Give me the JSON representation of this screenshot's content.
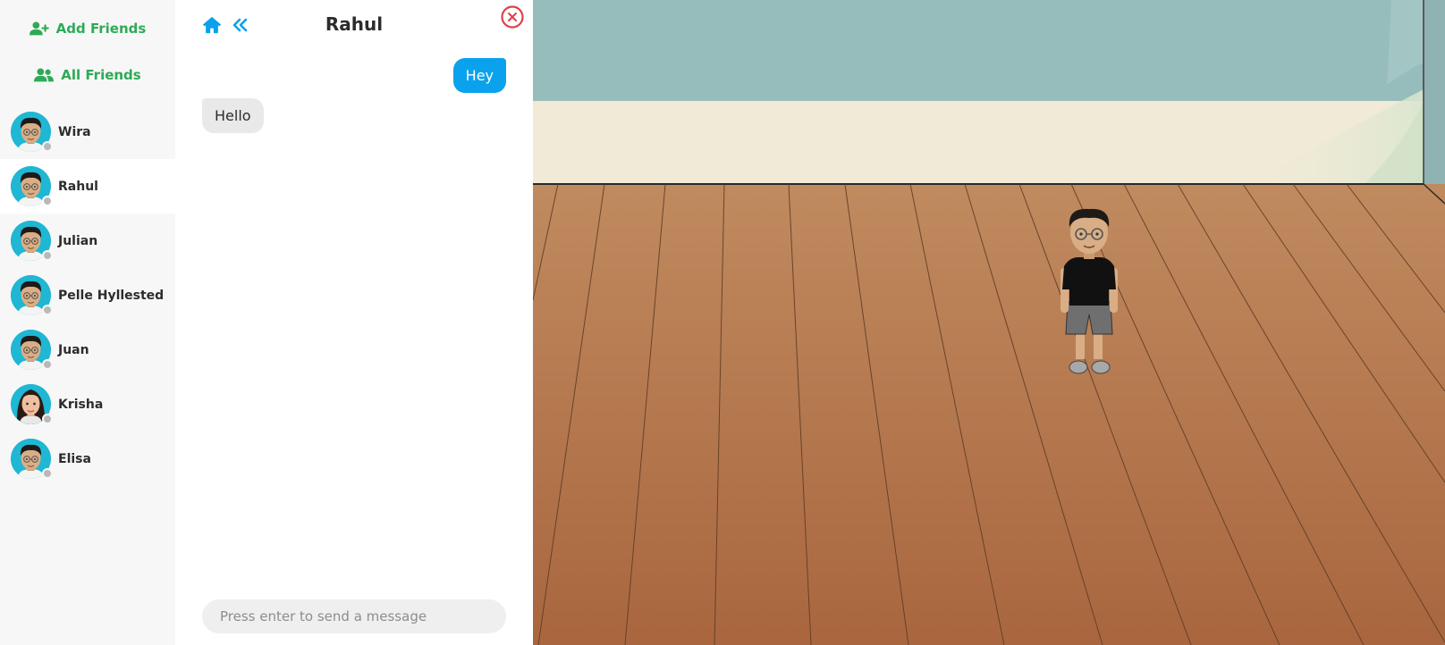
{
  "sidebar": {
    "add_friends_label": "Add Friends",
    "all_friends_label": "All Friends",
    "friends": [
      {
        "name": "Wira",
        "avatar": "male",
        "status": "offline",
        "active": false
      },
      {
        "name": "Rahul",
        "avatar": "male",
        "status": "offline",
        "active": true
      },
      {
        "name": "Julian",
        "avatar": "male",
        "status": "offline",
        "active": false
      },
      {
        "name": "Pelle Hyllested",
        "avatar": "male",
        "status": "offline",
        "active": false
      },
      {
        "name": "Juan",
        "avatar": "male",
        "status": "offline",
        "active": false
      },
      {
        "name": "Krisha",
        "avatar": "female",
        "status": "offline",
        "active": false
      },
      {
        "name": "Elisa",
        "avatar": "male",
        "status": "offline",
        "active": false
      }
    ]
  },
  "chat": {
    "title": "Rahul",
    "messages": [
      {
        "direction": "outgoing",
        "text": "Hey"
      },
      {
        "direction": "incoming",
        "text": "Hello"
      }
    ],
    "composer_placeholder": "Press enter to send a message"
  },
  "icons": {
    "home": "home-icon",
    "back": "double-chevron-left-icon",
    "close": "close-circle-icon",
    "add_friend": "user-plus-icon",
    "all_friends": "users-icon"
  },
  "colors": {
    "accent_green": "#2eaa56",
    "accent_blue": "#0aa2ec",
    "close_red": "#e0414b",
    "avatar_bg": "#1fb7d3",
    "wall_teal": "#96bcbc",
    "wall_cream": "#f0ead6",
    "floor_wood": "#bb7f55"
  }
}
